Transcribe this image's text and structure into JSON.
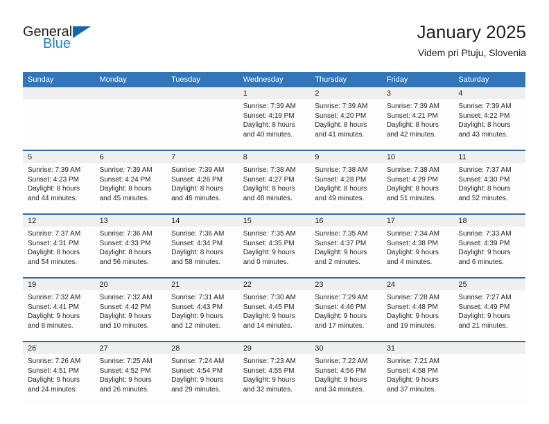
{
  "brand": {
    "name_part1": "General",
    "name_part2": "Blue",
    "triangle_icon": "triangle-icon",
    "accent_color": "#1f7fc4",
    "triangle_color": "#1566ad"
  },
  "header": {
    "title": "January 2025",
    "subtitle": "Videm pri Ptuju, Slovenia"
  },
  "theme": {
    "header_band": "#3275b8",
    "row_divider": "#2e6da4",
    "daynum_band": "#efefef",
    "text": "#231f20"
  },
  "weekday_headers": [
    "Sunday",
    "Monday",
    "Tuesday",
    "Wednesday",
    "Thursday",
    "Friday",
    "Saturday"
  ],
  "weeks": [
    [
      {
        "day": "",
        "lines": []
      },
      {
        "day": "",
        "lines": []
      },
      {
        "day": "",
        "lines": []
      },
      {
        "day": "1",
        "lines": [
          "Sunrise: 7:39 AM",
          "Sunset: 4:19 PM",
          "Daylight: 8 hours",
          "and 40 minutes."
        ]
      },
      {
        "day": "2",
        "lines": [
          "Sunrise: 7:39 AM",
          "Sunset: 4:20 PM",
          "Daylight: 8 hours",
          "and 41 minutes."
        ]
      },
      {
        "day": "3",
        "lines": [
          "Sunrise: 7:39 AM",
          "Sunset: 4:21 PM",
          "Daylight: 8 hours",
          "and 42 minutes."
        ]
      },
      {
        "day": "4",
        "lines": [
          "Sunrise: 7:39 AM",
          "Sunset: 4:22 PM",
          "Daylight: 8 hours",
          "and 43 minutes."
        ]
      }
    ],
    [
      {
        "day": "5",
        "lines": [
          "Sunrise: 7:39 AM",
          "Sunset: 4:23 PM",
          "Daylight: 8 hours",
          "and 44 minutes."
        ]
      },
      {
        "day": "6",
        "lines": [
          "Sunrise: 7:39 AM",
          "Sunset: 4:24 PM",
          "Daylight: 8 hours",
          "and 45 minutes."
        ]
      },
      {
        "day": "7",
        "lines": [
          "Sunrise: 7:39 AM",
          "Sunset: 4:26 PM",
          "Daylight: 8 hours",
          "and 46 minutes."
        ]
      },
      {
        "day": "8",
        "lines": [
          "Sunrise: 7:38 AM",
          "Sunset: 4:27 PM",
          "Daylight: 8 hours",
          "and 48 minutes."
        ]
      },
      {
        "day": "9",
        "lines": [
          "Sunrise: 7:38 AM",
          "Sunset: 4:28 PM",
          "Daylight: 8 hours",
          "and 49 minutes."
        ]
      },
      {
        "day": "10",
        "lines": [
          "Sunrise: 7:38 AM",
          "Sunset: 4:29 PM",
          "Daylight: 8 hours",
          "and 51 minutes."
        ]
      },
      {
        "day": "11",
        "lines": [
          "Sunrise: 7:37 AM",
          "Sunset: 4:30 PM",
          "Daylight: 8 hours",
          "and 52 minutes."
        ]
      }
    ],
    [
      {
        "day": "12",
        "lines": [
          "Sunrise: 7:37 AM",
          "Sunset: 4:31 PM",
          "Daylight: 8 hours",
          "and 54 minutes."
        ]
      },
      {
        "day": "13",
        "lines": [
          "Sunrise: 7:36 AM",
          "Sunset: 4:33 PM",
          "Daylight: 8 hours",
          "and 56 minutes."
        ]
      },
      {
        "day": "14",
        "lines": [
          "Sunrise: 7:36 AM",
          "Sunset: 4:34 PM",
          "Daylight: 8 hours",
          "and 58 minutes."
        ]
      },
      {
        "day": "15",
        "lines": [
          "Sunrise: 7:35 AM",
          "Sunset: 4:35 PM",
          "Daylight: 9 hours",
          "and 0 minutes."
        ]
      },
      {
        "day": "16",
        "lines": [
          "Sunrise: 7:35 AM",
          "Sunset: 4:37 PM",
          "Daylight: 9 hours",
          "and 2 minutes."
        ]
      },
      {
        "day": "17",
        "lines": [
          "Sunrise: 7:34 AM",
          "Sunset: 4:38 PM",
          "Daylight: 9 hours",
          "and 4 minutes."
        ]
      },
      {
        "day": "18",
        "lines": [
          "Sunrise: 7:33 AM",
          "Sunset: 4:39 PM",
          "Daylight: 9 hours",
          "and 6 minutes."
        ]
      }
    ],
    [
      {
        "day": "19",
        "lines": [
          "Sunrise: 7:32 AM",
          "Sunset: 4:41 PM",
          "Daylight: 9 hours",
          "and 8 minutes."
        ]
      },
      {
        "day": "20",
        "lines": [
          "Sunrise: 7:32 AM",
          "Sunset: 4:42 PM",
          "Daylight: 9 hours",
          "and 10 minutes."
        ]
      },
      {
        "day": "21",
        "lines": [
          "Sunrise: 7:31 AM",
          "Sunset: 4:43 PM",
          "Daylight: 9 hours",
          "and 12 minutes."
        ]
      },
      {
        "day": "22",
        "lines": [
          "Sunrise: 7:30 AM",
          "Sunset: 4:45 PM",
          "Daylight: 9 hours",
          "and 14 minutes."
        ]
      },
      {
        "day": "23",
        "lines": [
          "Sunrise: 7:29 AM",
          "Sunset: 4:46 PM",
          "Daylight: 9 hours",
          "and 17 minutes."
        ]
      },
      {
        "day": "24",
        "lines": [
          "Sunrise: 7:28 AM",
          "Sunset: 4:48 PM",
          "Daylight: 9 hours",
          "and 19 minutes."
        ]
      },
      {
        "day": "25",
        "lines": [
          "Sunrise: 7:27 AM",
          "Sunset: 4:49 PM",
          "Daylight: 9 hours",
          "and 21 minutes."
        ]
      }
    ],
    [
      {
        "day": "26",
        "lines": [
          "Sunrise: 7:26 AM",
          "Sunset: 4:51 PM",
          "Daylight: 9 hours",
          "and 24 minutes."
        ]
      },
      {
        "day": "27",
        "lines": [
          "Sunrise: 7:25 AM",
          "Sunset: 4:52 PM",
          "Daylight: 9 hours",
          "and 26 minutes."
        ]
      },
      {
        "day": "28",
        "lines": [
          "Sunrise: 7:24 AM",
          "Sunset: 4:54 PM",
          "Daylight: 9 hours",
          "and 29 minutes."
        ]
      },
      {
        "day": "29",
        "lines": [
          "Sunrise: 7:23 AM",
          "Sunset: 4:55 PM",
          "Daylight: 9 hours",
          "and 32 minutes."
        ]
      },
      {
        "day": "30",
        "lines": [
          "Sunrise: 7:22 AM",
          "Sunset: 4:56 PM",
          "Daylight: 9 hours",
          "and 34 minutes."
        ]
      },
      {
        "day": "31",
        "lines": [
          "Sunrise: 7:21 AM",
          "Sunset: 4:58 PM",
          "Daylight: 9 hours",
          "and 37 minutes."
        ]
      },
      {
        "day": "",
        "lines": []
      }
    ]
  ]
}
